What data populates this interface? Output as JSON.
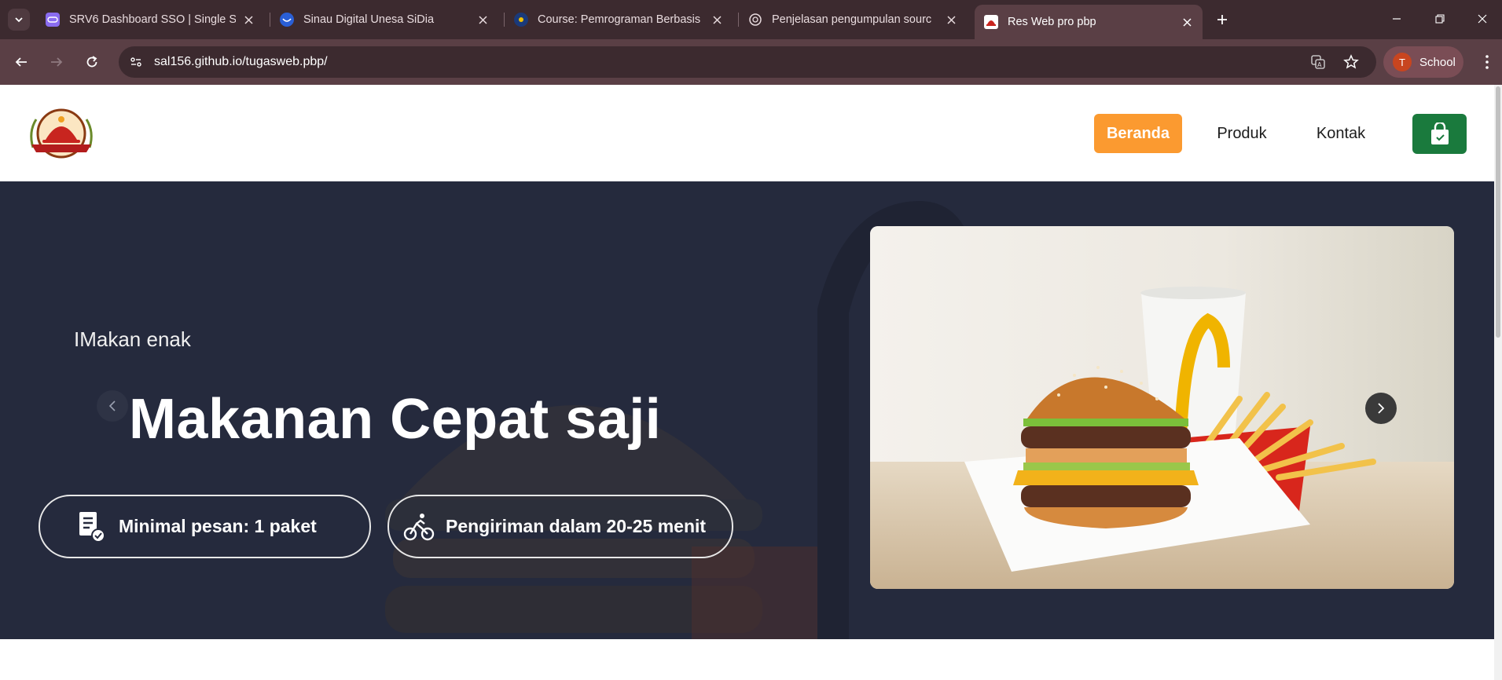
{
  "browser": {
    "tabs": [
      {
        "title": "SRV6 Dashboard SSO | Single Si",
        "favicon": "srv6-icon"
      },
      {
        "title": "Sinau Digital Unesa SiDia",
        "favicon": "sidia-icon"
      },
      {
        "title": "Course: Pemrograman Berbasis",
        "favicon": "unesa-icon"
      },
      {
        "title": "Penjelasan pengumpulan sourc",
        "favicon": "chatgpt-icon"
      },
      {
        "title": "Res Web pro pbp",
        "favicon": "restaurant-icon",
        "active": true
      }
    ],
    "url": "sal156.github.io/tugasweb.pbp/",
    "profile": {
      "initial": "T",
      "label": "School"
    }
  },
  "site": {
    "nav": [
      {
        "label": "Beranda",
        "active": true
      },
      {
        "label": "Produk",
        "active": false
      },
      {
        "label": "Kontak",
        "active": false
      }
    ],
    "hero": {
      "subtitle": "IMakan enak",
      "title": "Makanan Cepat saji",
      "pills": [
        {
          "label": "Minimal pesan: 1 paket",
          "icon": "order-list-icon"
        },
        {
          "label": "Pengiriman dalam 20-25 menit",
          "icon": "delivery-bike-icon"
        }
      ]
    }
  },
  "colors": {
    "accent_orange": "#fb9a30",
    "cart_green": "#1a7a3d",
    "hero_bg": "#252a3d",
    "chrome_dark": "#3c2a2f",
    "chrome_mid": "#5a3f45"
  }
}
